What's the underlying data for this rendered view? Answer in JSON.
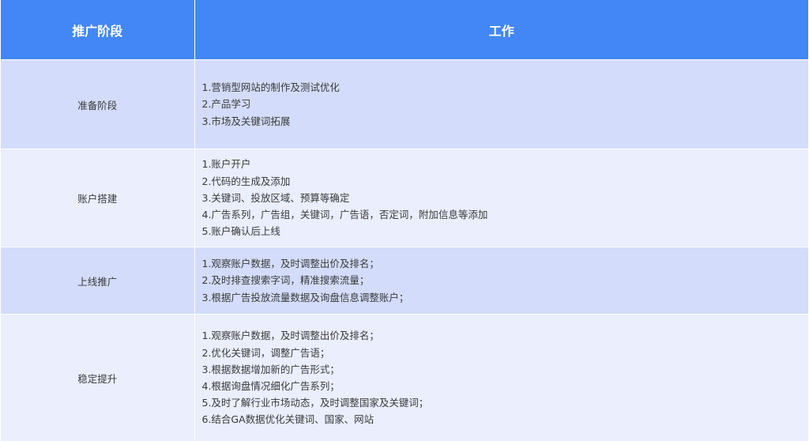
{
  "table": {
    "headers": [
      "推广阶段",
      "工作"
    ],
    "rows": [
      {
        "stage": "准备阶段",
        "items": [
          "1.营销型网站的制作及测试优化",
          "2.产品学习",
          "3.市场及关键词拓展"
        ]
      },
      {
        "stage": "账户搭建",
        "items": [
          "1.账户开户",
          "2.代码的生成及添加",
          "3.关键词、投放区域、预算等确定",
          "4.广告系列，广告组，关键词，广告语，否定词，附加信息等添加",
          "5.账户确认后上线"
        ]
      },
      {
        "stage": "上线推广",
        "items": [
          "1.观察账户数据，及时调整出价及排名；",
          "2.及时排查搜索字词，精准搜索流量；",
          "3.根据广告投放流量数据及询盘信息调整账户；"
        ]
      },
      {
        "stage": "稳定提升",
        "items": [
          "1.观察账户数据，及时调整出价及排名；",
          "2.优化关键词，调整广告语；",
          "3.根据数据增加新的广告形式；",
          "4.根据询盘情况细化广告系列；",
          "5.及时了解行业市场动态，及时调整国家及关键词；",
          "6.结合GA数据优化关键词、国家、网站"
        ]
      }
    ]
  },
  "colors": {
    "header_bg": "#4287f5",
    "row_dark_bg": "#d3dcfa",
    "row_light_bg": "#eaeefd",
    "text": "#3a3a3a"
  }
}
